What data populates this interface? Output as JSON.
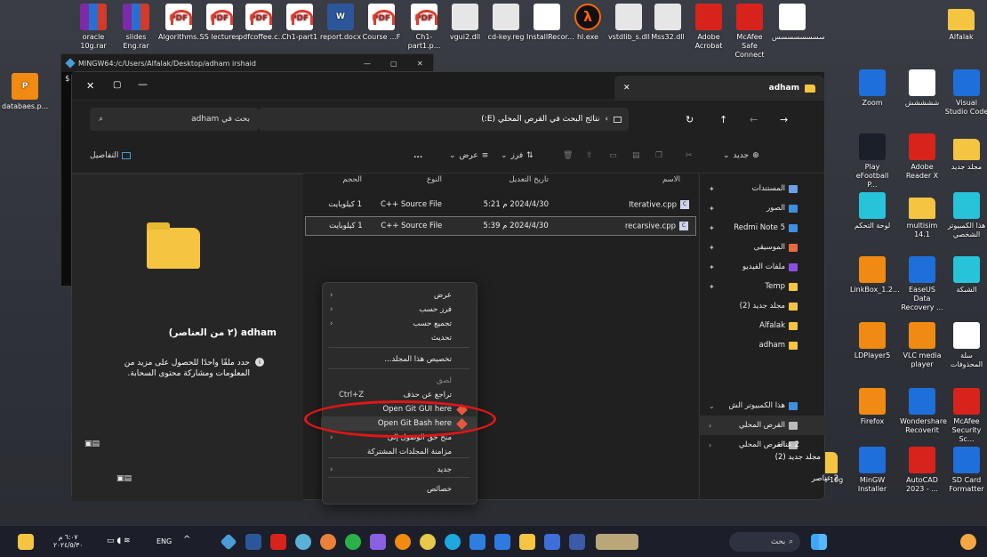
{
  "desktop": {
    "top_icons": [
      {
        "label": "oracle 10g.rar",
        "kind": "rar"
      },
      {
        "label": "slides Eng.rar",
        "kind": "rar"
      },
      {
        "label": "Algorithms...",
        "kind": "pdf"
      },
      {
        "label": "SS lectures",
        "kind": "pdf"
      },
      {
        "label": "pdfcoffee.c...",
        "kind": "pdf"
      },
      {
        "label": "Ch1-part1",
        "kind": "pdf"
      },
      {
        "label": "report.docx",
        "kind": "word"
      },
      {
        "label": "Course ...F",
        "kind": "pdf"
      },
      {
        "label": "Ch1-part1.p...",
        "kind": "pdf"
      },
      {
        "label": "vgui2.dll",
        "kind": "dll"
      },
      {
        "label": "cd-key.reg",
        "kind": "dll"
      },
      {
        "label": "InstallRecor...",
        "kind": "doc"
      },
      {
        "label": "hl.exe",
        "kind": "lam"
      },
      {
        "label": "vstdlib_s.dll",
        "kind": "dll"
      },
      {
        "label": "Mss32.dll",
        "kind": "dll"
      },
      {
        "label": "Adobe Acrobat",
        "kind": "red"
      },
      {
        "label": "McAfee Safe Connect",
        "kind": "red"
      },
      {
        "label": "سسسسسسسس",
        "kind": "doc"
      },
      {
        "label": "Alfalak",
        "kind": "folder"
      }
    ],
    "left_icon": {
      "label": "databaes.p..."
    },
    "right_icons": [
      {
        "label": "Zoom",
        "kind": "blue"
      },
      {
        "label": "ششششش",
        "kind": "doc"
      },
      {
        "label": "Visual Studio Code",
        "kind": "blue"
      },
      {
        "label": "Play eFootball P...",
        "kind": "dark"
      },
      {
        "label": "Adobe Reader X",
        "kind": "red"
      },
      {
        "label": "مجلد جديد",
        "kind": "folder"
      },
      {
        "label": "لوحة التحكم",
        "kind": "teal"
      },
      {
        "label": "multisim 14.1",
        "kind": "folder"
      },
      {
        "label": "هذا الكمبيوتر الشخصي",
        "kind": "teal"
      },
      {
        "label": "LinkBox_1.2...",
        "kind": "orange"
      },
      {
        "label": "EaseUS Data Recovery ...",
        "kind": "blue"
      },
      {
        "label": "الشبكة",
        "kind": "teal"
      },
      {
        "label": "LDPlayer5",
        "kind": "orange"
      },
      {
        "label": "VLC media player",
        "kind": "orange"
      },
      {
        "label": "سلة المحذوفات",
        "kind": "doc"
      },
      {
        "label": "Firefox",
        "kind": "orange"
      },
      {
        "label": "Wondershare Recoverit",
        "kind": "blue"
      },
      {
        "label": "McAfee Security Sc...",
        "kind": "red"
      },
      {
        "label": "oracle 10g",
        "kind": "folder"
      },
      {
        "label": "MinGW Installer",
        "kind": "blue"
      },
      {
        "label": "AutoCAD 2023 - ...",
        "kind": "red"
      },
      {
        "label": "SD Card Formatter",
        "kind": "blue"
      }
    ]
  },
  "terminal": {
    "title": "MINGW64:/c/Users/Alfalak/Desktop/adham irshaid",
    "prompt": "$"
  },
  "explorer": {
    "tab_title": "adham",
    "search_placeholder": "بحث في adham",
    "address": "نتائج البحث في القرص المحلي (E:)",
    "cmd_new": "جديد",
    "cmd_sort": "فرز",
    "cmd_view": "عرض",
    "cmd_more": "...",
    "cmd_details": "التفاصيل",
    "columns": {
      "name": "الاسم",
      "modified": "تاريخ التعديل",
      "type": "النوع",
      "size": "الحجم"
    },
    "files": [
      {
        "name": "Iterative.cpp",
        "modified": "2024/4/30 م 5:21",
        "type": "C++ Source File",
        "size": "1 كيلوبايت"
      },
      {
        "name": "recarsive.cpp",
        "modified": "2024/4/30 م 5:39",
        "type": "C++ Source File",
        "size": "1 كيلوبايت"
      }
    ],
    "details_pane": {
      "title": "adham (٢ من العناصر)",
      "info": "حدد ملفًا واحدًا للحصول على مزيد من المعلومات ومشاركة محتوى السحابة."
    },
    "nav": [
      {
        "label": "المستندات",
        "color": "#6aa0e8",
        "pinned": true
      },
      {
        "label": "الصور",
        "color": "#3e8fe0",
        "pinned": true
      },
      {
        "label": "Redmi Note 5",
        "color": "#3e8fe0",
        "pinned": true
      },
      {
        "label": "الموسيقى",
        "color": "#e86a3e",
        "pinned": true
      },
      {
        "label": "ملفات الفيديو",
        "color": "#8a4fe0",
        "pinned": true
      },
      {
        "label": "Temp",
        "color": "#f5c542",
        "pinned": true
      },
      {
        "label": "مجلد جديد (2)",
        "color": "#f5c542",
        "pinned": false
      },
      {
        "label": "Alfalak",
        "color": "#f5c542",
        "pinned": false
      },
      {
        "label": "adham",
        "color": "#f5c542",
        "pinned": false
      }
    ],
    "nav_this_pc": "هذا الكمبيوتر الش",
    "nav_drive1": "القرص المحلي",
    "nav_drive2": "القرص المحلي",
    "status_count": "2 عناصر",
    "status_folder": "مجلد جديد (2)",
    "status_count2": "2 عناصر"
  },
  "context_menu": {
    "items": [
      {
        "label": "عرض",
        "sub": true
      },
      {
        "label": "فرز حسب",
        "sub": true
      },
      {
        "label": "تجميع حسب",
        "sub": true
      },
      {
        "label": "تحديث",
        "sub": false
      },
      {
        "label": "تخصيص هذا المجلد...",
        "sub": false
      },
      {
        "label": "لصق",
        "sub": false,
        "dim": true
      },
      {
        "label": "تراجع عن حذف",
        "shortcut": "Ctrl+Z"
      },
      {
        "label": "Open Git GUI here",
        "git": true
      },
      {
        "label": "Open Git Bash here",
        "git": true
      },
      {
        "label": "منح حق الوصول إلى",
        "sub": true
      },
      {
        "label": "مزامنة المجلدات المشتركة",
        "sub": false
      },
      {
        "label": "جديد",
        "sub": true
      },
      {
        "label": "خصائص",
        "sub": false
      }
    ]
  },
  "taskbar": {
    "time": "٦:٠٧ م",
    "date": "٢٠٢٤/٥/٣٠",
    "lang": "ENG",
    "search": "بحث"
  }
}
